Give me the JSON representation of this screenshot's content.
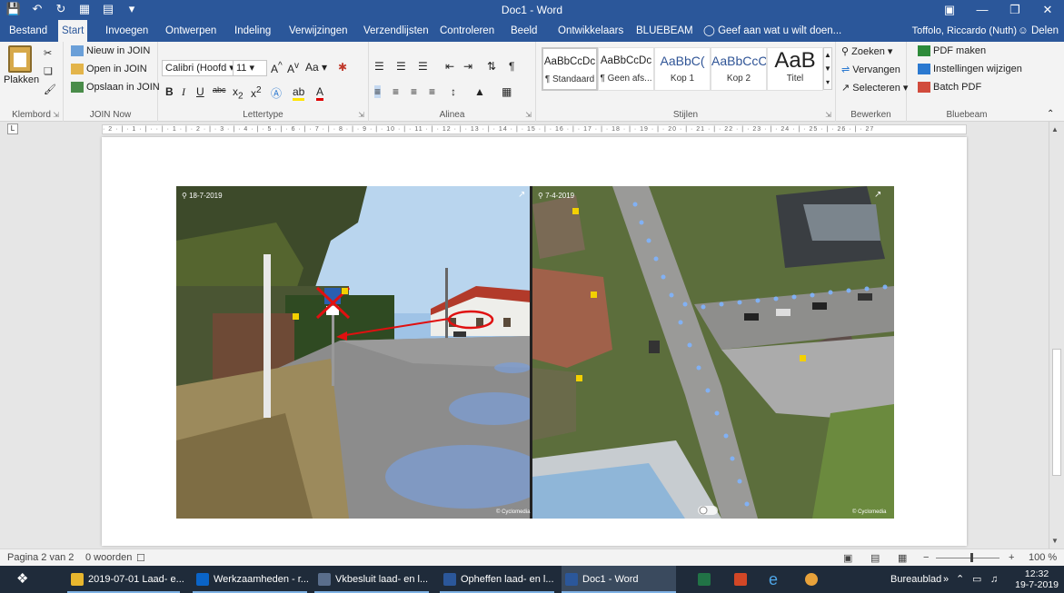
{
  "window": {
    "title": "Doc1 - Word"
  },
  "tabs": {
    "items": [
      "Bestand",
      "Start",
      "Invoegen",
      "Ontwerpen",
      "Indeling",
      "Verwijzingen",
      "Verzendlijsten",
      "Controleren",
      "Beeld",
      "Ontwikkelaars",
      "BLUEBEAM"
    ],
    "tell_me": "Geef aan wat u wilt doen...",
    "user": "Toffolo, Riccardo (Nuth)",
    "share": "Delen"
  },
  "ribbon": {
    "clipboard": {
      "label": "Klembord",
      "paste": "Plakken"
    },
    "join": {
      "label": "JOIN Now",
      "new": "Nieuw in JOIN",
      "open": "Open in JOIN",
      "save": "Opslaan in JOIN"
    },
    "font": {
      "label": "Lettertype",
      "family": "Calibri (Hoofd",
      "size": "11",
      "case": "Aa"
    },
    "paragraph": {
      "label": "Alinea"
    },
    "styles": {
      "label": "Stijlen",
      "items": [
        {
          "sample": "AaBbCcDc",
          "name": "¶ Standaard"
        },
        {
          "sample": "AaBbCcDc",
          "name": "¶ Geen afs..."
        },
        {
          "sample": "AaBbC(",
          "name": "Kop 1"
        },
        {
          "sample": "AaBbCcC",
          "name": "Kop 2"
        },
        {
          "sample": "AaB",
          "name": "Titel"
        }
      ]
    },
    "editing": {
      "label": "Bewerken",
      "find": "Zoeken",
      "replace": "Vervangen",
      "select": "Selecteren"
    },
    "bluebeam": {
      "label": "Bluebeam",
      "pdf": "PDF maken",
      "settings": "Instellingen wijzigen",
      "batch": "Batch PDF"
    }
  },
  "ruler": {
    "ticks": "· 2 · | · 1 · | ·  · | · 1 · | · 2 · | · 3 · | · 4 · | · 5 · | · 6 · | · 7 · | · 8 · | · 9 · | · 10 · | · 11 · | · 12 · | · 13 · | · 14 · | · 15 · | · 16 · | · 17 · | · 18 · | · 19 · | · 20 · | · 21 · | · 22 · | · 23 · | · 24 · | · 25 · | · 26 · | · 27"
  },
  "image": {
    "left_date": "18-7-2019",
    "right_date": "7-4-2019",
    "watermark_left": "© Cyclomedia",
    "watermark_right": "© Cyclomedia"
  },
  "status": {
    "page": "Pagina 2 van 2",
    "words": "0 woorden",
    "zoom": "100 %"
  },
  "taskbar": {
    "items": [
      {
        "label": "2019-07-01 Laad- e...",
        "color": "#e8b62e"
      },
      {
        "label": "Werkzaamheden - r...",
        "color": "#0a64c8"
      },
      {
        "label": "Vkbesluit laad- en l...",
        "color": "#5a6e8c"
      },
      {
        "label": "Opheffen laad- en l...",
        "color": "#2b579a"
      },
      {
        "label": "Doc1 - Word",
        "color": "#2b579a"
      }
    ],
    "desktop": "Bureaublad",
    "time": "12:32",
    "date": "19-7-2019"
  }
}
